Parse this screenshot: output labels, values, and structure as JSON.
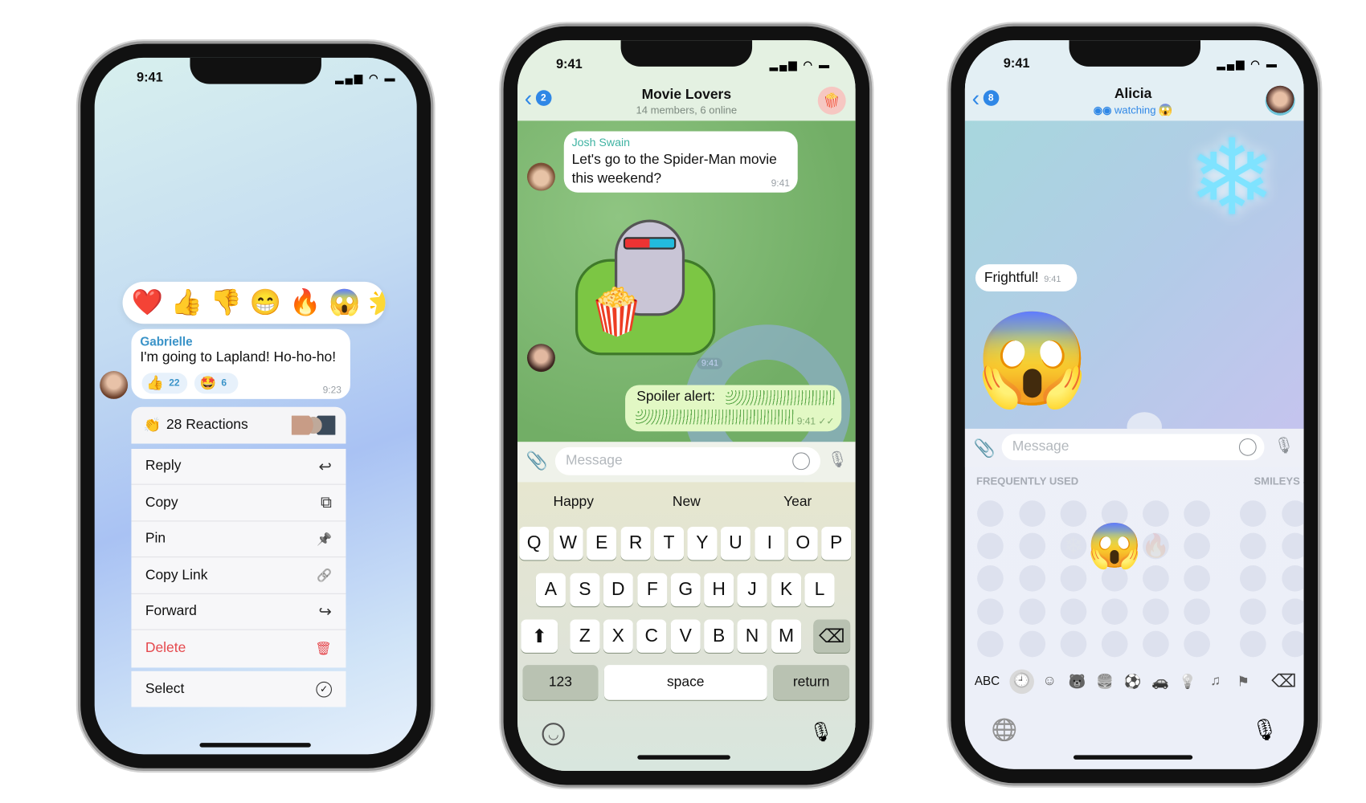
{
  "status_time": "9:41",
  "phone1": {
    "reactions_bar": [
      "❤️",
      "👍",
      "👎",
      "😁",
      "🔥",
      "😱",
      "🌟"
    ],
    "message": {
      "sender": "Gabrielle",
      "text": "I'm going to Lapland! Ho-ho-ho!",
      "time": "9:23",
      "reactions": [
        {
          "emoji": "👍",
          "count": "22"
        },
        {
          "emoji": "🤩",
          "count": "6"
        }
      ]
    },
    "reactions_summary": {
      "icon": "👏",
      "label": "28 Reactions"
    },
    "menu": [
      {
        "label": "Reply",
        "icon": "↩"
      },
      {
        "label": "Copy",
        "icon": "⧉"
      },
      {
        "label": "Pin",
        "icon": "📌"
      },
      {
        "label": "Copy Link",
        "icon": "🔗"
      },
      {
        "label": "Forward",
        "icon": "↪"
      },
      {
        "label": "Delete",
        "icon": "🗑"
      }
    ],
    "select": {
      "label": "Select",
      "icon": "✓"
    },
    "delete_color": "#e5484d"
  },
  "phone2": {
    "back_badge": "2",
    "title": "Movie Lovers",
    "subtitle": "14 members, 6 online",
    "header_avatar": "🍿",
    "msg1": {
      "sender": "Josh Swain",
      "text": "Let's go to the Spider-Man movie this weekend?",
      "time": "9:41"
    },
    "sticker": {
      "glyph": "🍿",
      "time": "9:41"
    },
    "msg2": {
      "text": "Spoiler alert:",
      "time": "9:41 ✓✓"
    },
    "input_placeholder": "Message",
    "suggestions": [
      "Happy",
      "New",
      "Year"
    ],
    "rows": [
      [
        "Q",
        "W",
        "E",
        "R",
        "T",
        "Y",
        "U",
        "I",
        "O",
        "P"
      ],
      [
        "A",
        "S",
        "D",
        "F",
        "G",
        "H",
        "J",
        "K",
        "L"
      ],
      [
        "Z",
        "X",
        "C",
        "V",
        "B",
        "N",
        "M"
      ]
    ],
    "shift": "⬆",
    "backspace": "⌫",
    "numbers_key": "123",
    "space_key": "space",
    "return_key": "return",
    "accent": "#5fb24f"
  },
  "phone3": {
    "back_badge": "8",
    "title": "Alicia",
    "status": "watching",
    "status_emoji": "😱",
    "snowflake": "❄",
    "msg": {
      "text": "Frightful!",
      "time": "9:41"
    },
    "big_emoji": "😱",
    "input_placeholder": "Message",
    "section_frequent": "FREQUENTLY USED",
    "section_smileys": "SMILEYS &",
    "picked_emoji": "😱",
    "faded": [
      "❄",
      "🔥"
    ],
    "abc": "ABC",
    "categories": [
      "🕘",
      "☺",
      "🐻",
      "🍔",
      "⚽",
      "🚗",
      "💡",
      "♫",
      "⚑"
    ],
    "backspace": "⌫",
    "globe": "🌐",
    "mic": "🎙"
  }
}
